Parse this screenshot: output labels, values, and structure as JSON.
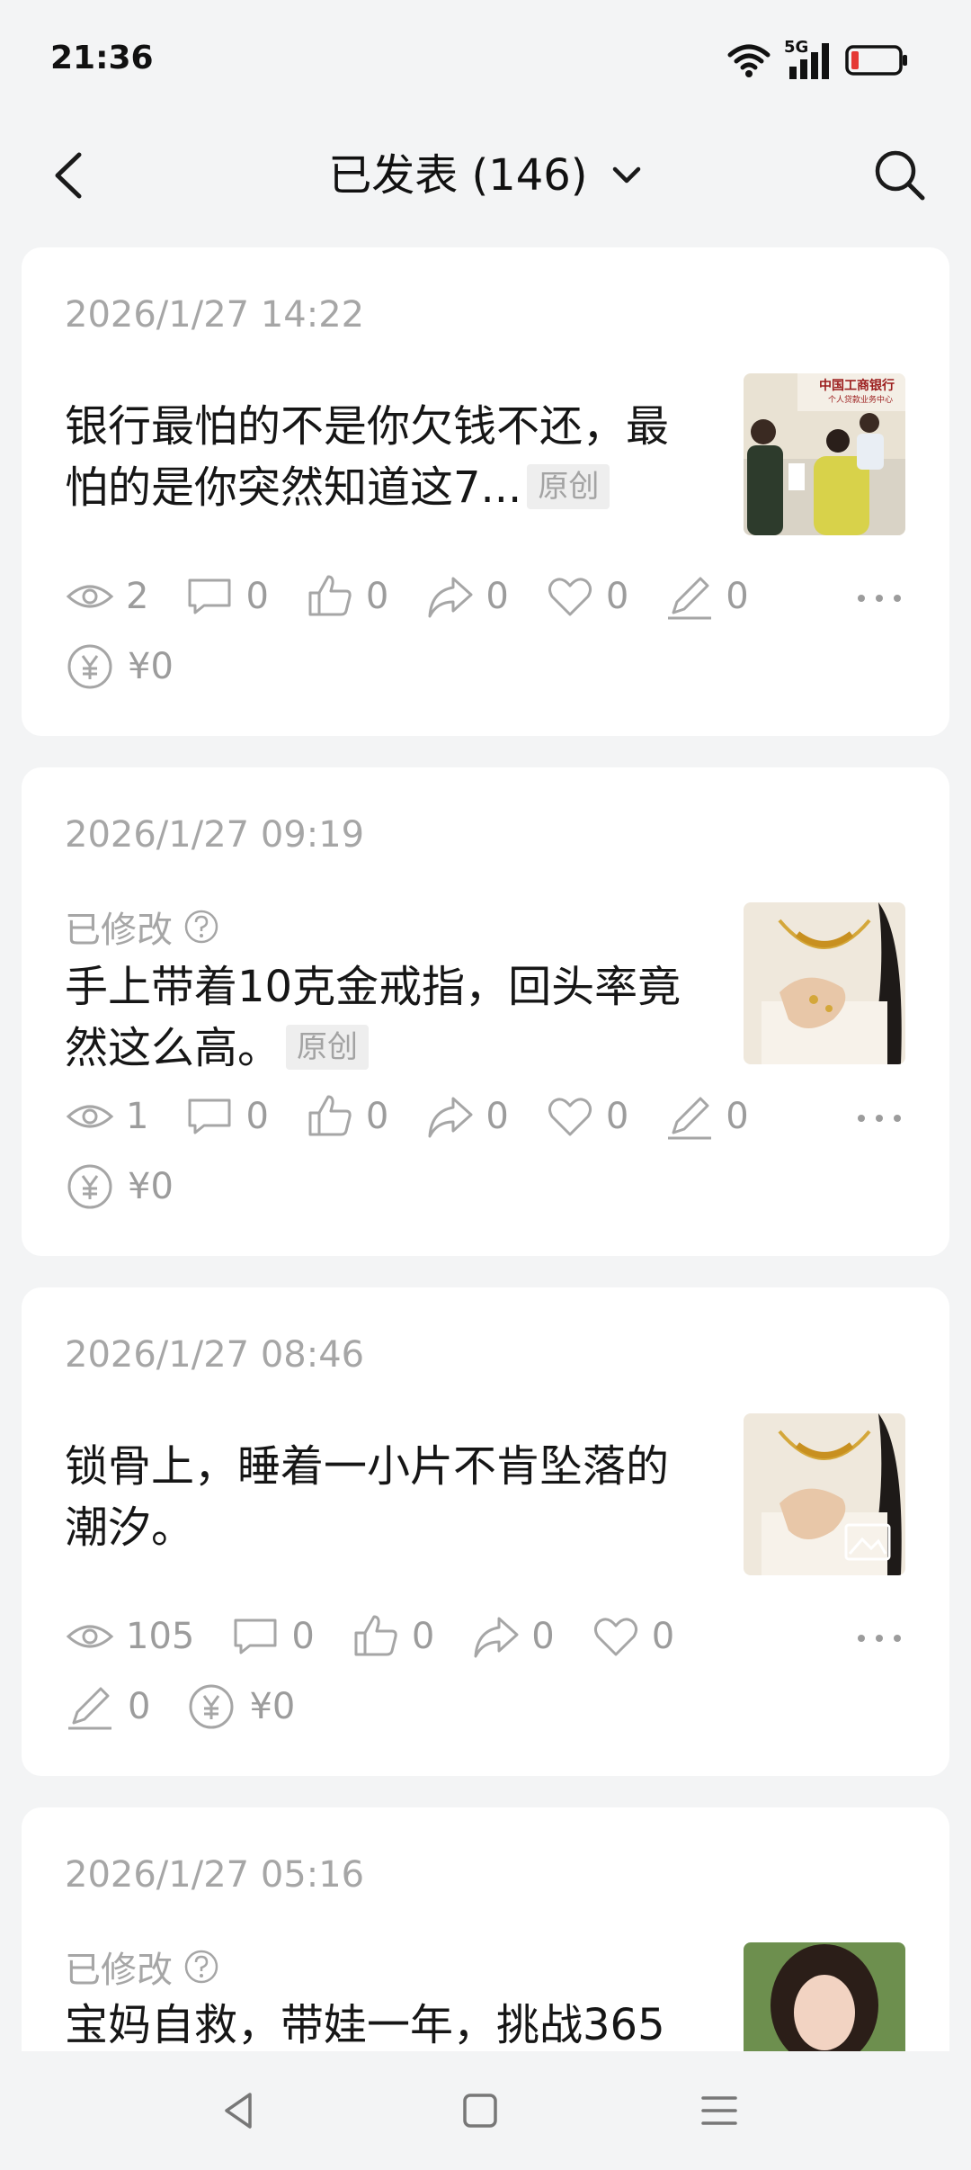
{
  "status_bar": {
    "time": "21:36",
    "network": "5G"
  },
  "header": {
    "title": "已发表 (146)"
  },
  "posts": [
    {
      "date": "2026/1/27 14:22",
      "modified": "",
      "title": "银行最怕的不是你欠钱不还，最怕的是你突然知道这7...",
      "tag": "原创",
      "thumb_caption": "中国工商银行",
      "thumb_subcaption": "个人贷款业务中心",
      "stats": {
        "views": "2",
        "comments": "0",
        "likes": "0",
        "shares": "0",
        "favorites": "0",
        "edits": "0",
        "income": "¥0"
      }
    },
    {
      "date": "2026/1/27 09:19",
      "modified": "已修改",
      "title": "手上带着10克金戒指，回头率竟然这么高。",
      "tag": "原创",
      "stats": {
        "views": "1",
        "comments": "0",
        "likes": "0",
        "shares": "0",
        "favorites": "0",
        "edits": "0",
        "income": "¥0"
      }
    },
    {
      "date": "2026/1/27 08:46",
      "modified": "",
      "title": "锁骨上，睡着一小片不肯坠落的潮汐。",
      "tag": "",
      "stats": {
        "views": "105",
        "comments": "0",
        "likes": "0",
        "shares": "0",
        "favorites": "0",
        "edits": "0",
        "income": "¥0"
      }
    },
    {
      "date": "2026/1/27 05:16",
      "modified": "已修改",
      "title": "宝妈自救，带娃一年，挑战365",
      "tag": "",
      "stats": {}
    }
  ]
}
